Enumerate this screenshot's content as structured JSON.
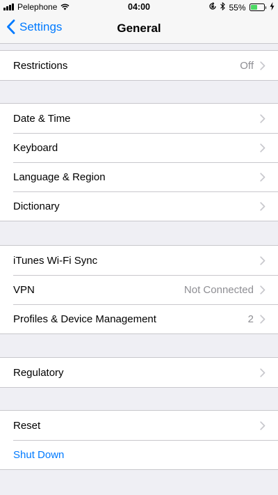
{
  "status_bar": {
    "carrier": "Pelephone",
    "time": "04:00",
    "battery_percent": "55%",
    "battery_level": 0.55,
    "icons": [
      "signal-icon",
      "wifi-icon",
      "orientation-lock-icon",
      "bluetooth-icon",
      "battery-icon",
      "charging-icon"
    ]
  },
  "nav": {
    "back_label": "Settings",
    "title": "General"
  },
  "groups": [
    {
      "rows": [
        {
          "label": "Restrictions",
          "value": "Off"
        }
      ]
    },
    {
      "rows": [
        {
          "label": "Date & Time"
        },
        {
          "label": "Keyboard"
        },
        {
          "label": "Language & Region"
        },
        {
          "label": "Dictionary"
        }
      ]
    },
    {
      "rows": [
        {
          "label": "iTunes Wi-Fi Sync"
        },
        {
          "label": "VPN",
          "value": "Not Connected"
        },
        {
          "label": "Profiles & Device Management",
          "value": "2"
        }
      ]
    },
    {
      "rows": [
        {
          "label": "Regulatory"
        }
      ]
    },
    {
      "rows": [
        {
          "label": "Reset"
        },
        {
          "label": "Shut Down"
        }
      ]
    }
  ],
  "colors": {
    "accent": "#007aff",
    "background": "#efeff4",
    "battery": "#4cd964",
    "secondary_text": "#8e8e93"
  }
}
